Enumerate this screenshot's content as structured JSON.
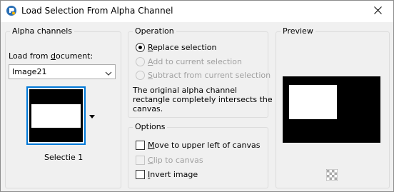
{
  "window": {
    "title": "Load Selection From Alpha Channel"
  },
  "alpha_channels": {
    "group_title": "Alpha channels",
    "load_from_label_pre": "Load from ",
    "load_from_label_u": "d",
    "load_from_label_post": "ocument:",
    "document_value": "Image21",
    "thumbnail_caption": "Selectie 1"
  },
  "operation": {
    "group_title": "Operation",
    "options": [
      {
        "u": "R",
        "rest": "eplace selection",
        "selected": true,
        "enabled": true
      },
      {
        "u": "A",
        "rest": "dd to current selection",
        "selected": false,
        "enabled": false
      },
      {
        "u": "S",
        "rest": "ubtract from current selection",
        "selected": false,
        "enabled": false
      }
    ],
    "description_line1": "The original alpha channel",
    "description_line2": "rectangle completely intersects the",
    "description_line3": "canvas."
  },
  "options": {
    "group_title": "Options",
    "items": [
      {
        "u": "M",
        "rest": "ove to upper left of canvas",
        "checked": false,
        "enabled": true
      },
      {
        "u": "C",
        "rest": "lip to canvas",
        "checked": false,
        "enabled": false
      },
      {
        "u": "I",
        "rest": "nvert image",
        "checked": false,
        "enabled": true
      }
    ]
  },
  "preview": {
    "group_title": "Preview"
  },
  "icons": {
    "app": "paintshop-icon",
    "close": "close-icon",
    "dropdown": "chevron-down-icon",
    "thumb_menu": "triangle-down-icon",
    "preview_toggle": "checkerboard-icon"
  },
  "colors": {
    "accent": "#0078d7",
    "window_bg": "#f0f0f0",
    "disabled_text": "#a0a0a0"
  }
}
